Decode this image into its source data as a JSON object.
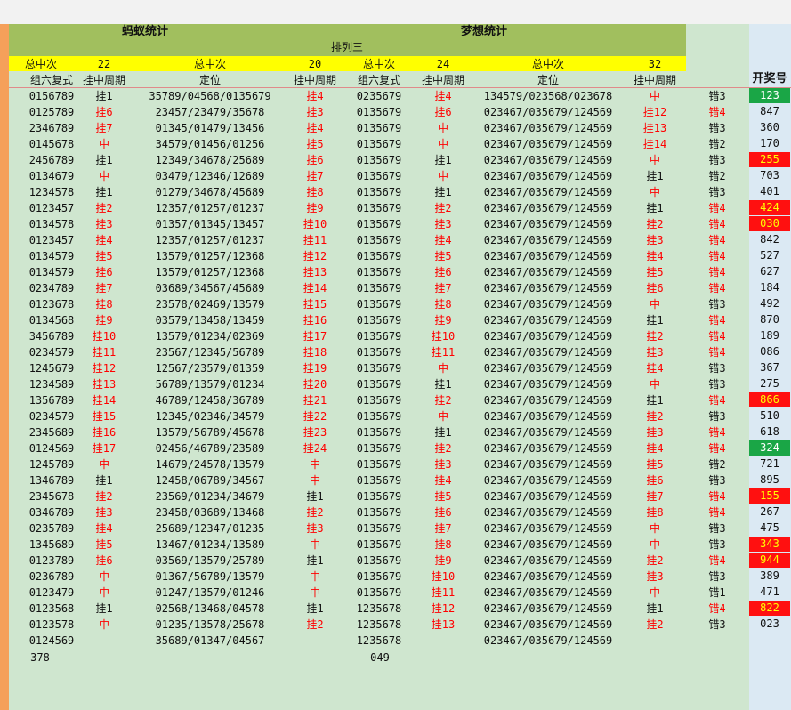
{
  "titles": {
    "left": "蚂蚁统计",
    "right": "梦想统计",
    "sub": "排列三"
  },
  "yellow": {
    "total1": "总中次",
    "count1": "22",
    "total2": "总中次",
    "count2": "20",
    "total3": "总中次",
    "count3": "24",
    "total4": "总中次",
    "count4": "32"
  },
  "headers": {
    "c1": "组六复式",
    "c2": "挂中周期",
    "c3": "定位",
    "c4": "挂中周期",
    "c5": "组六复式",
    "c6": "挂中周期",
    "c7": "定位",
    "c8": "挂中周期",
    "kjh": "开奖号"
  },
  "colors": {
    "green": "#1aa646",
    "red": "#ff1010",
    "orange": "#f5a05a",
    "olive": "#a1bf5e",
    "yellow": "#ffff00"
  },
  "rows": [
    [
      "0156789",
      "挂1",
      "35789/04568/0135679",
      "挂4",
      "0235679",
      "挂4",
      "134579/023568/023678",
      "中",
      "错3",
      "123",
      "g"
    ],
    [
      "0125789",
      "挂6",
      "23457/23479/35678",
      "挂3",
      "0135679",
      "挂6",
      "023467/035679/124569",
      "挂12",
      "错4",
      "847",
      ""
    ],
    [
      "2346789",
      "挂7",
      "01345/01479/13456",
      "挂4",
      "0135679",
      "中",
      "023467/035679/124569",
      "挂13",
      "错3",
      "360",
      ""
    ],
    [
      "0145678",
      "中",
      "34579/01456/01256",
      "挂5",
      "0135679",
      "中",
      "023467/035679/124569",
      "挂14",
      "错2",
      "170",
      ""
    ],
    [
      "2456789",
      "挂1",
      "12349/34678/25689",
      "挂6",
      "0135679",
      "挂1",
      "023467/035679/124569",
      "中",
      "错3",
      "255",
      "r"
    ],
    [
      "0134679",
      "中",
      "03479/12346/12689",
      "挂7",
      "0135679",
      "中",
      "023467/035679/124569",
      "挂1",
      "错2",
      "703",
      ""
    ],
    [
      "1234578",
      "挂1",
      "01279/34678/45689",
      "挂8",
      "0135679",
      "挂1",
      "023467/035679/124569",
      "中",
      "错3",
      "401",
      ""
    ],
    [
      "0123457",
      "挂2",
      "12357/01257/01237",
      "挂9",
      "0135679",
      "挂2",
      "023467/035679/124569",
      "挂1",
      "错4",
      "424",
      "r"
    ],
    [
      "0134578",
      "挂3",
      "01357/01345/13457",
      "挂10",
      "0135679",
      "挂3",
      "023467/035679/124569",
      "挂2",
      "错4",
      "030",
      "r"
    ],
    [
      "0123457",
      "挂4",
      "12357/01257/01237",
      "挂11",
      "0135679",
      "挂4",
      "023467/035679/124569",
      "挂3",
      "错4",
      "842",
      ""
    ],
    [
      "0134579",
      "挂5",
      "13579/01257/12368",
      "挂12",
      "0135679",
      "挂5",
      "023467/035679/124569",
      "挂4",
      "错4",
      "527",
      ""
    ],
    [
      "0134579",
      "挂6",
      "13579/01257/12368",
      "挂13",
      "0135679",
      "挂6",
      "023467/035679/124569",
      "挂5",
      "错4",
      "627",
      ""
    ],
    [
      "0234789",
      "挂7",
      "03689/34567/45689",
      "挂14",
      "0135679",
      "挂7",
      "023467/035679/124569",
      "挂6",
      "错4",
      "184",
      ""
    ],
    [
      "0123678",
      "挂8",
      "23578/02469/13579",
      "挂15",
      "0135679",
      "挂8",
      "023467/035679/124569",
      "中",
      "错3",
      "492",
      ""
    ],
    [
      "0134568",
      "挂9",
      "03579/13458/13459",
      "挂16",
      "0135679",
      "挂9",
      "023467/035679/124569",
      "挂1",
      "错4",
      "870",
      ""
    ],
    [
      "3456789",
      "挂10",
      "13579/01234/02369",
      "挂17",
      "0135679",
      "挂10",
      "023467/035679/124569",
      "挂2",
      "错4",
      "189",
      ""
    ],
    [
      "0234579",
      "挂11",
      "23567/12345/56789",
      "挂18",
      "0135679",
      "挂11",
      "023467/035679/124569",
      "挂3",
      "错4",
      "086",
      ""
    ],
    [
      "1245679",
      "挂12",
      "12567/23579/01359",
      "挂19",
      "0135679",
      "中",
      "023467/035679/124569",
      "挂4",
      "错3",
      "367",
      ""
    ],
    [
      "1234589",
      "挂13",
      "56789/13579/01234",
      "挂20",
      "0135679",
      "挂1",
      "023467/035679/124569",
      "中",
      "错3",
      "275",
      ""
    ],
    [
      "1356789",
      "挂14",
      "46789/12458/36789",
      "挂21",
      "0135679",
      "挂2",
      "023467/035679/124569",
      "挂1",
      "错4",
      "866",
      "r"
    ],
    [
      "0234579",
      "挂15",
      "12345/02346/34579",
      "挂22",
      "0135679",
      "中",
      "023467/035679/124569",
      "挂2",
      "错3",
      "510",
      ""
    ],
    [
      "2345689",
      "挂16",
      "13579/56789/45678",
      "挂23",
      "0135679",
      "挂1",
      "023467/035679/124569",
      "挂3",
      "错4",
      "618",
      ""
    ],
    [
      "0124569",
      "挂17",
      "02456/46789/23589",
      "挂24",
      "0135679",
      "挂2",
      "023467/035679/124569",
      "挂4",
      "错4",
      "324",
      "g"
    ],
    [
      "1245789",
      "中",
      "14679/24578/13579",
      "中",
      "0135679",
      "挂3",
      "023467/035679/124569",
      "挂5",
      "错2",
      "721",
      ""
    ],
    [
      "1346789",
      "挂1",
      "12458/06789/34567",
      "中",
      "0135679",
      "挂4",
      "023467/035679/124569",
      "挂6",
      "错3",
      "895",
      ""
    ],
    [
      "2345678",
      "挂2",
      "23569/01234/34679",
      "挂1",
      "0135679",
      "挂5",
      "023467/035679/124569",
      "挂7",
      "错4",
      "155",
      "r"
    ],
    [
      "0346789",
      "挂3",
      "23458/03689/13468",
      "挂2",
      "0135679",
      "挂6",
      "023467/035679/124569",
      "挂8",
      "错4",
      "267",
      ""
    ],
    [
      "0235789",
      "挂4",
      "25689/12347/01235",
      "挂3",
      "0135679",
      "挂7",
      "023467/035679/124569",
      "中",
      "错3",
      "475",
      ""
    ],
    [
      "1345689",
      "挂5",
      "13467/01234/13589",
      "中",
      "0135679",
      "挂8",
      "023467/035679/124569",
      "中",
      "错3",
      "343",
      "r"
    ],
    [
      "0123789",
      "挂6",
      "03569/13579/25789",
      "挂1",
      "0135679",
      "挂9",
      "023467/035679/124569",
      "挂2",
      "错4",
      "944",
      "r"
    ],
    [
      "0236789",
      "中",
      "01367/56789/13579",
      "中",
      "0135679",
      "挂10",
      "023467/035679/124569",
      "挂3",
      "错3",
      "389",
      ""
    ],
    [
      "0123479",
      "中",
      "01247/13579/01246",
      "中",
      "0135679",
      "挂11",
      "023467/035679/124569",
      "中",
      "错1",
      "471",
      ""
    ],
    [
      "0123568",
      "挂1",
      "02568/13468/04578",
      "挂1",
      "1235678",
      "挂12",
      "023467/035679/124569",
      "挂1",
      "错4",
      "822",
      "r"
    ],
    [
      "0123578",
      "中",
      "01235/13578/25678",
      "挂2",
      "1235678",
      "挂13",
      "023467/035679/124569",
      "挂2",
      "错3",
      "023",
      ""
    ],
    [
      "0124569",
      "",
      "35689/01347/04567",
      "",
      "1235678",
      "",
      "023467/035679/124569",
      "",
      "",
      "",
      ""
    ]
  ],
  "footer": {
    "left": "378",
    "right": "049"
  }
}
